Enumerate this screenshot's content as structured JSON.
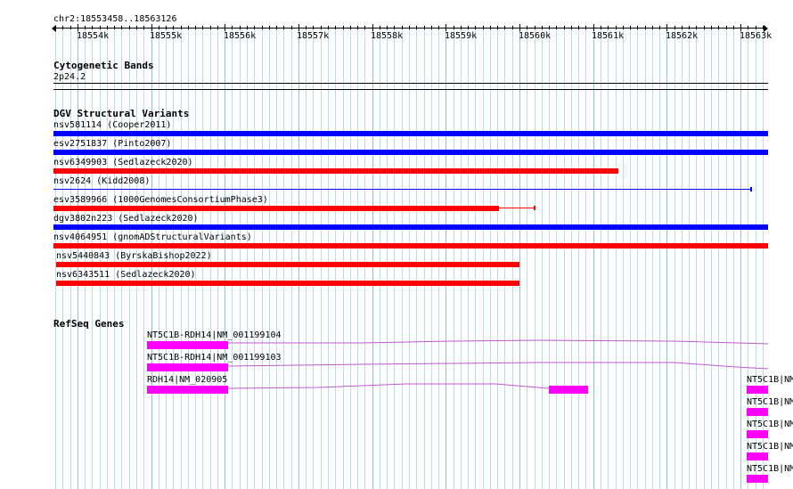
{
  "ruler": {
    "location": "chr2:18553458..18563126",
    "ticks": [
      "18554k",
      "18555k",
      "18556k",
      "18557k",
      "18558k",
      "18559k",
      "18560k",
      "18561k",
      "18562k",
      "18563k"
    ]
  },
  "cytobands": {
    "title": "Cytogenetic Bands",
    "band": "2p24.2"
  },
  "dgv": {
    "title": "DGV Structural Variants",
    "items": [
      {
        "label": "nsv581114 (Cooper2011)",
        "color": "#0000ff"
      },
      {
        "label": "esv2751837 (Pinto2007)",
        "color": "#0000ff"
      },
      {
        "label": "nsv6349903 (Sedlazeck2020)",
        "color": "#ff0000"
      },
      {
        "label": "nsv2624 (Kidd2008)",
        "color": "#0000ff"
      },
      {
        "label": "esv3589966 (1000GenomesConsortiumPhase3)",
        "color": "#ff0000"
      },
      {
        "label": "dgv3802n223 (Sedlazeck2020)",
        "color": "#0000ff"
      },
      {
        "label": "nsv4064951 (gnomADStructuralVariants)",
        "color": "#ff0000"
      },
      {
        "label": "nsv5440843 (ByrskaBishop2022)",
        "color": "#ff0000"
      },
      {
        "label": "nsv6343511 (Sedlazeck2020)",
        "color": "#ff0000"
      }
    ]
  },
  "refseq": {
    "title": "RefSeq Genes",
    "genes": [
      {
        "label": "NT5C1B-RDH14|NM_001199104"
      },
      {
        "label": "NT5C1B-RDH14|NM_001199103"
      },
      {
        "label": "RDH14|NM_020905"
      },
      {
        "label": "NT5C1B|NM"
      },
      {
        "label": "NT5C1B|NM"
      },
      {
        "label": "NT5C1B|NM"
      },
      {
        "label": "NT5C1B|NM"
      },
      {
        "label": "NT5C1B|NM"
      }
    ]
  },
  "colors": {
    "blue": "#0000ff",
    "red": "#ff0000",
    "exon": "#ff00ff",
    "intron": "#c058d0",
    "grid": "#b7dcec"
  }
}
